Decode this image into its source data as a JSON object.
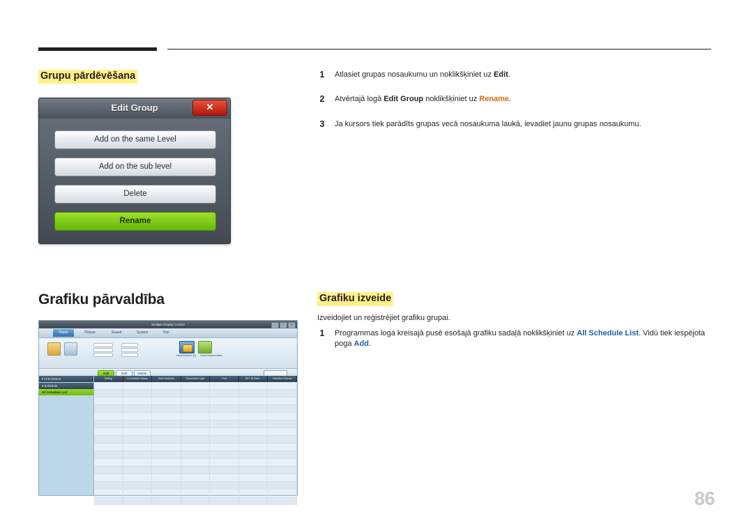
{
  "page": {
    "number": "86"
  },
  "left_column": {
    "section_title": "Grupu pārdēvēšana",
    "managing_title": "Grafiku pārvaldība"
  },
  "dialog": {
    "title": "Edit Group",
    "close_label": "✕",
    "buttons": [
      {
        "label": "Add on the same Level"
      },
      {
        "label": "Add on the sub level"
      },
      {
        "label": "Delete"
      },
      {
        "label": "Rename"
      }
    ]
  },
  "steps": [
    {
      "num": "1",
      "parts": [
        {
          "t": "Atlasiet grupas nosaukumu un noklikšķiniet uz ",
          "s": "plain"
        },
        {
          "t": "Edit",
          "s": "bold"
        },
        {
          "t": ".",
          "s": "plain"
        }
      ]
    },
    {
      "num": "2",
      "parts": [
        {
          "t": "Atvērtajā logā ",
          "s": "plain"
        },
        {
          "t": "Edit Group",
          "s": "bold"
        },
        {
          "t": " noklikšķiniet uz ",
          "s": "plain"
        },
        {
          "t": "Rename",
          "s": "orange"
        },
        {
          "t": ".",
          "s": "plain"
        }
      ]
    },
    {
      "num": "3",
      "parts": [
        {
          "t": "Ja kursors tiek parādīts grupas vecā nosaukuma laukā, ievadiet jaunu grupas nosaukumu.",
          "s": "plain"
        }
      ]
    }
  ],
  "right_column": {
    "section_title": "Grafiku izveide",
    "intro": "Izveidojiet un reģistrējiet grafiku grupai.",
    "step": {
      "num": "1",
      "parts": [
        {
          "t": "Programmas loga kreisajā pusē esošajā grafiku sadaļā noklikšķiniet uz ",
          "s": "plain"
        },
        {
          "t": "All Schedule List",
          "s": "blue"
        },
        {
          "t": ". Vidū tiek iespējota poga ",
          "s": "plain"
        },
        {
          "t": "Add",
          "s": "blue"
        },
        {
          "t": ".",
          "s": "plain"
        }
      ]
    }
  },
  "mdc": {
    "window_title": "Multiple Display Control",
    "window_buttons": [
      "—",
      "□",
      "✕"
    ],
    "menu_tabs": [
      "Home",
      "Picture",
      "Sound",
      "System",
      "Tool"
    ],
    "ribbon_labels": [
      "Fault Device\n(0)",
      "Fault Device\nAlert"
    ],
    "toolbar_buttons": [
      "Add",
      "Edit",
      "Delete"
    ],
    "tree": {
      "header_lfd": "LFD Device",
      "header_schedule": "Schedule",
      "selected_item": "All Schedule List"
    },
    "grid_headers": [
      "Setting",
      "Connection Status",
      "MAC Address",
      "Connection Type",
      "Port",
      "SET ID Rest...",
      "Selected Grid set"
    ],
    "grid_row_count": 16
  },
  "colors": {
    "highlight": "#fff08a",
    "orange": "#e8650c",
    "blue": "#1c5fa8",
    "green_button": "#7ccb12",
    "close_red": "#c2221a",
    "page_number": "#c8c9cb"
  }
}
